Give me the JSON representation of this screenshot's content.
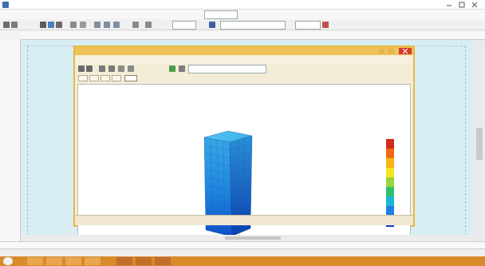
{
  "window": {
    "title": "",
    "accent": "#e8b840",
    "close_color": "#d63a2c"
  },
  "menubar": {
    "items": [
      "",
      "",
      "",
      "",
      "",
      ""
    ]
  },
  "toolbar": {
    "zoom_value": "",
    "layer_value": "",
    "stage_value": ""
  },
  "output_window": {
    "title": "",
    "menu_items": [
      "",
      "",
      "",
      "",
      "",
      "",
      "",
      "",
      ""
    ],
    "view_combo": "",
    "tabs": [
      "",
      "",
      "",
      "",
      ""
    ],
    "plot_caption_line1": "",
    "plot_caption_line2": "",
    "legend_title": "",
    "legend_values": [
      "",
      "",
      "",
      "",
      "",
      "",
      "",
      "",
      ""
    ],
    "status_text": ""
  },
  "command_line": {
    "text": ""
  },
  "status_bar": {
    "cells": [
      "",
      "",
      ""
    ]
  },
  "icons": [
    "app-icon",
    "minimize-icon",
    "maximize-icon",
    "close-icon",
    "new-file-icon",
    "open-file-icon",
    "save-icon",
    "print-icon",
    "zoom-in-icon",
    "zoom-out-icon",
    "pan-icon",
    "select-icon",
    "start-icon"
  ]
}
